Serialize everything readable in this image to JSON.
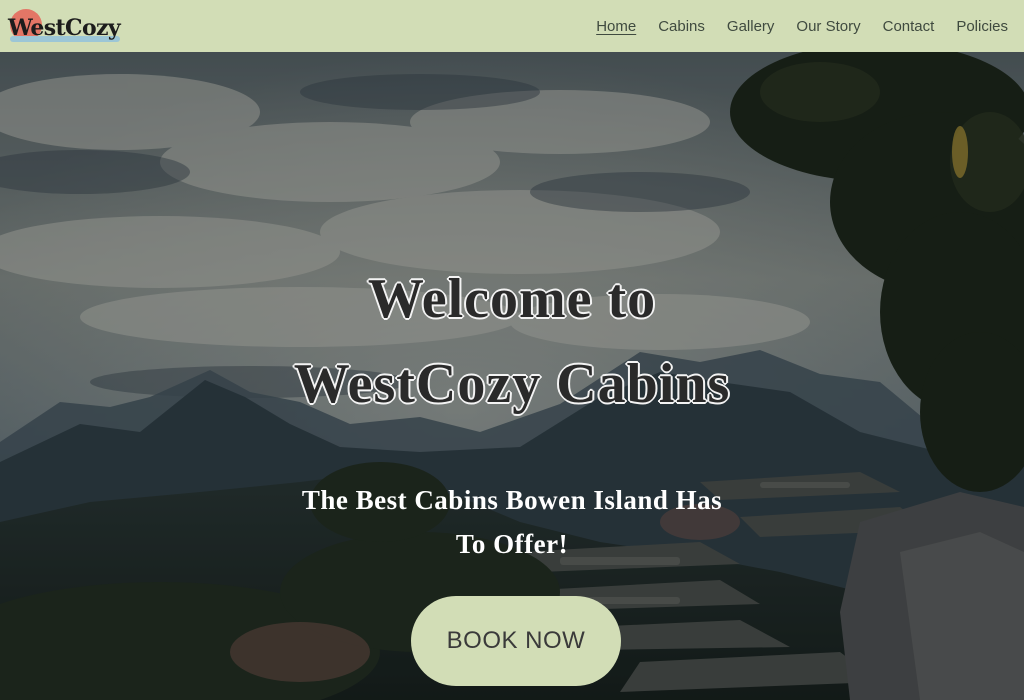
{
  "brand": {
    "logo_text": "WestCozy"
  },
  "nav": {
    "items": [
      {
        "label": "Home",
        "active": true
      },
      {
        "label": "Cabins",
        "active": false
      },
      {
        "label": "Gallery",
        "active": false
      },
      {
        "label": "Our Story",
        "active": false
      },
      {
        "label": "Contact",
        "active": false
      },
      {
        "label": "Policies",
        "active": false
      }
    ]
  },
  "hero": {
    "title_line1": "Welcome to",
    "title_line2": "WestCozy Cabins",
    "subtitle_line1": "The Best Cabins Bowen Island Has",
    "subtitle_line2": "To Offer!",
    "cta_label": "BOOK NOW"
  },
  "colors": {
    "header_bg": "#d2ddb6",
    "logo_sun": "#e37666",
    "logo_swash": "#9cc6d6",
    "cta_bg": "#d2ddb6"
  }
}
